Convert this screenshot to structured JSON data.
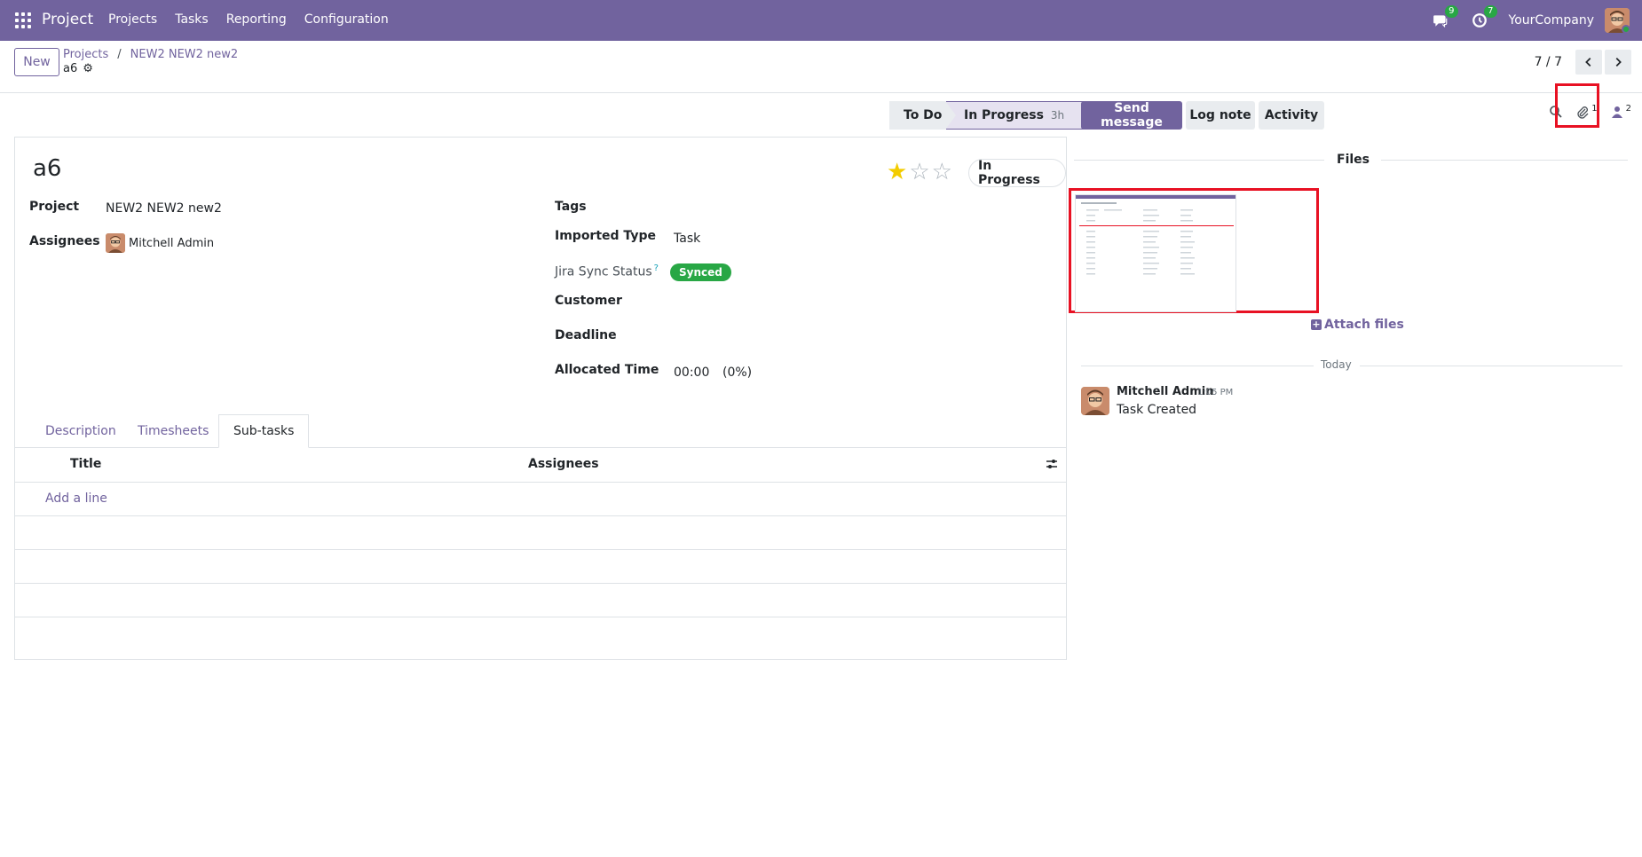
{
  "navbar": {
    "brand": "Project",
    "menu": [
      "Projects",
      "Tasks",
      "Reporting",
      "Configuration"
    ],
    "messages_badge": "9",
    "activities_badge": "7",
    "company": "YourCompany"
  },
  "control_panel": {
    "new_label": "New",
    "breadcrumb": [
      "Projects",
      "NEW2 NEW2 new2"
    ],
    "breadcrumb_sep": "/",
    "record_name": "a6",
    "pager": "7 / 7"
  },
  "statusbar": {
    "stages": [
      {
        "label": "To Do",
        "duration": ""
      },
      {
        "label": "In Progress",
        "duration": "3h"
      }
    ],
    "active_stage": "In Progress"
  },
  "form": {
    "title": "a6",
    "priority_stars": 3,
    "priority_filled": 1,
    "state": "In Progress",
    "project_label": "Project",
    "project_value": "NEW2 NEW2 new2",
    "assignees_label": "Assignees",
    "assignee_name": "Mitchell Admin",
    "tags_label": "Tags",
    "imported_type_label": "Imported Type",
    "imported_type_value": "Task",
    "jira_sync_label": "Jira Sync Status",
    "jira_sync_help": "?",
    "jira_sync_value": "Synced",
    "customer_label": "Customer",
    "deadline_label": "Deadline",
    "allocated_time_label": "Allocated Time",
    "allocated_time_value": "00:00",
    "allocated_time_percent": "(0%)"
  },
  "tabs": [
    "Description",
    "Timesheets",
    "Sub-tasks"
  ],
  "active_tab": "Sub-tasks",
  "subtasks": {
    "columns": [
      "Title",
      "Assignees"
    ],
    "add_line": "Add a line"
  },
  "chatter": {
    "send_message": "Send message",
    "log_note": "Log note",
    "activity": "Activity",
    "attachment_count": "1",
    "follower_count": "2",
    "files_title": "Files",
    "attach_files": "Attach files",
    "date_separator": "Today",
    "message": {
      "author": "Mitchell Admin",
      "time": "1:05 PM",
      "body": "Task Created"
    }
  },
  "colors": {
    "brand": "#71639e",
    "success": "#28a745",
    "highlight": "#e81123",
    "star": "#f3cc00"
  }
}
